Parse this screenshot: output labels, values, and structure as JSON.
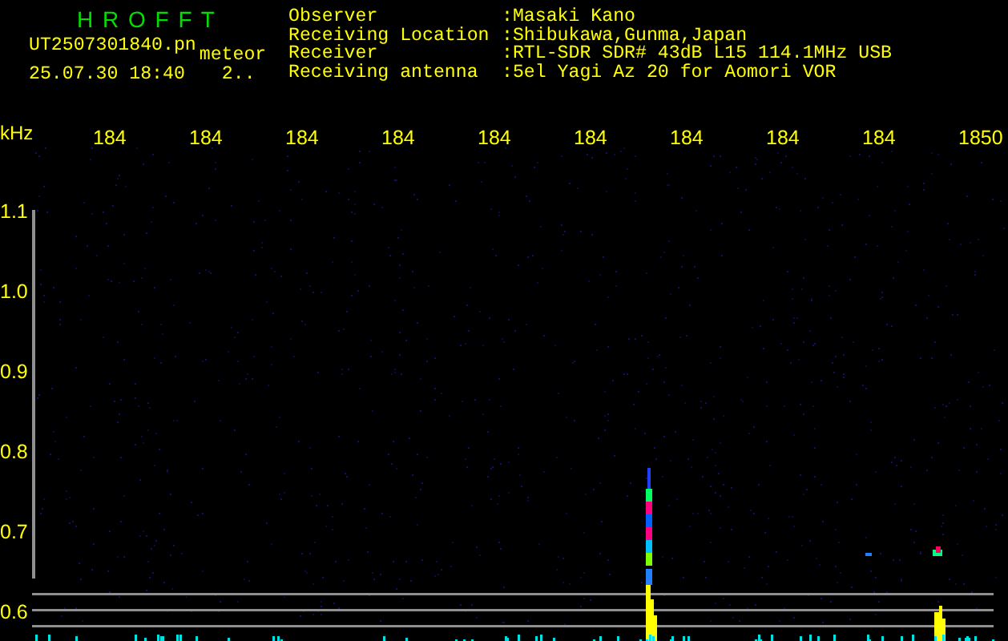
{
  "header": {
    "title": "H R O F F T",
    "filename": "UT2507301840.pn",
    "mode": "meteor",
    "timestamp": "25.07.30 18:40",
    "count": "2.."
  },
  "station_info": [
    {
      "label": "Observer",
      "value": ":Masaki Kano"
    },
    {
      "label": "Receiving Location",
      "value": ":Shibukawa,Gunma,Japan"
    },
    {
      "label": "Receiver",
      "value": ":RTL-SDR SDR# 43dB L15 114.1MHz USB"
    },
    {
      "label": "Receiving antenna",
      "value": ":5el Yagi Az 20 for Aomori VOR"
    }
  ],
  "spectrogram": {
    "y_unit": "kHz",
    "x_labels": [
      "184",
      "184",
      "184",
      "184",
      "184",
      "184",
      "184",
      "184",
      "184",
      "1850"
    ],
    "y_labels": [
      "1.1",
      "1.0",
      "0.9",
      "0.8",
      "0.7",
      "0.6"
    ]
  }
}
